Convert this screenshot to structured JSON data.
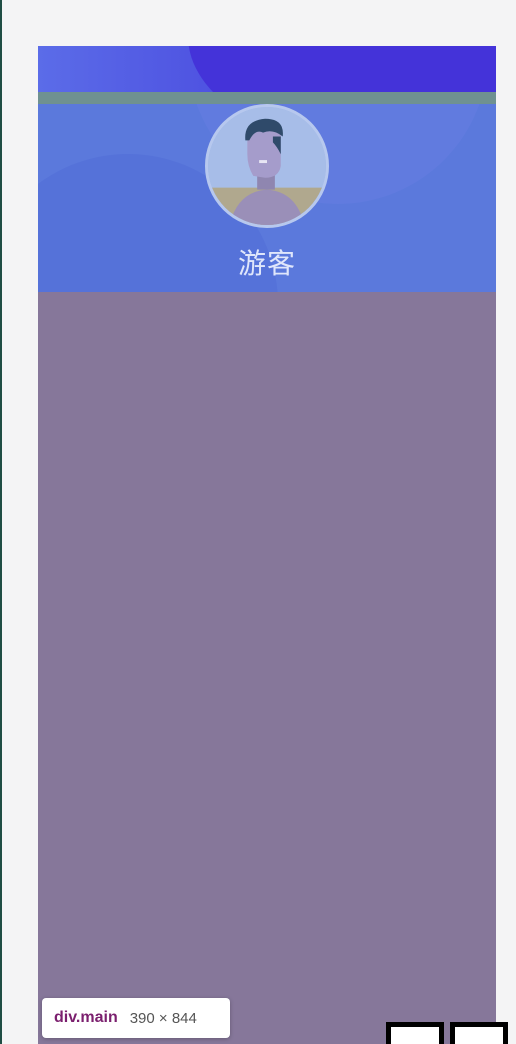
{
  "profile": {
    "username": "游客"
  },
  "inspector": {
    "element_tag": "div.main",
    "dimensions": "390 × 844"
  },
  "icons": {
    "avatar": "user-avatar-icon"
  },
  "colors": {
    "header_blue": "#5b79dc",
    "top_strip": "#4c4ee0",
    "main_overlay": "#86779a",
    "band_green": "#6f9191"
  }
}
